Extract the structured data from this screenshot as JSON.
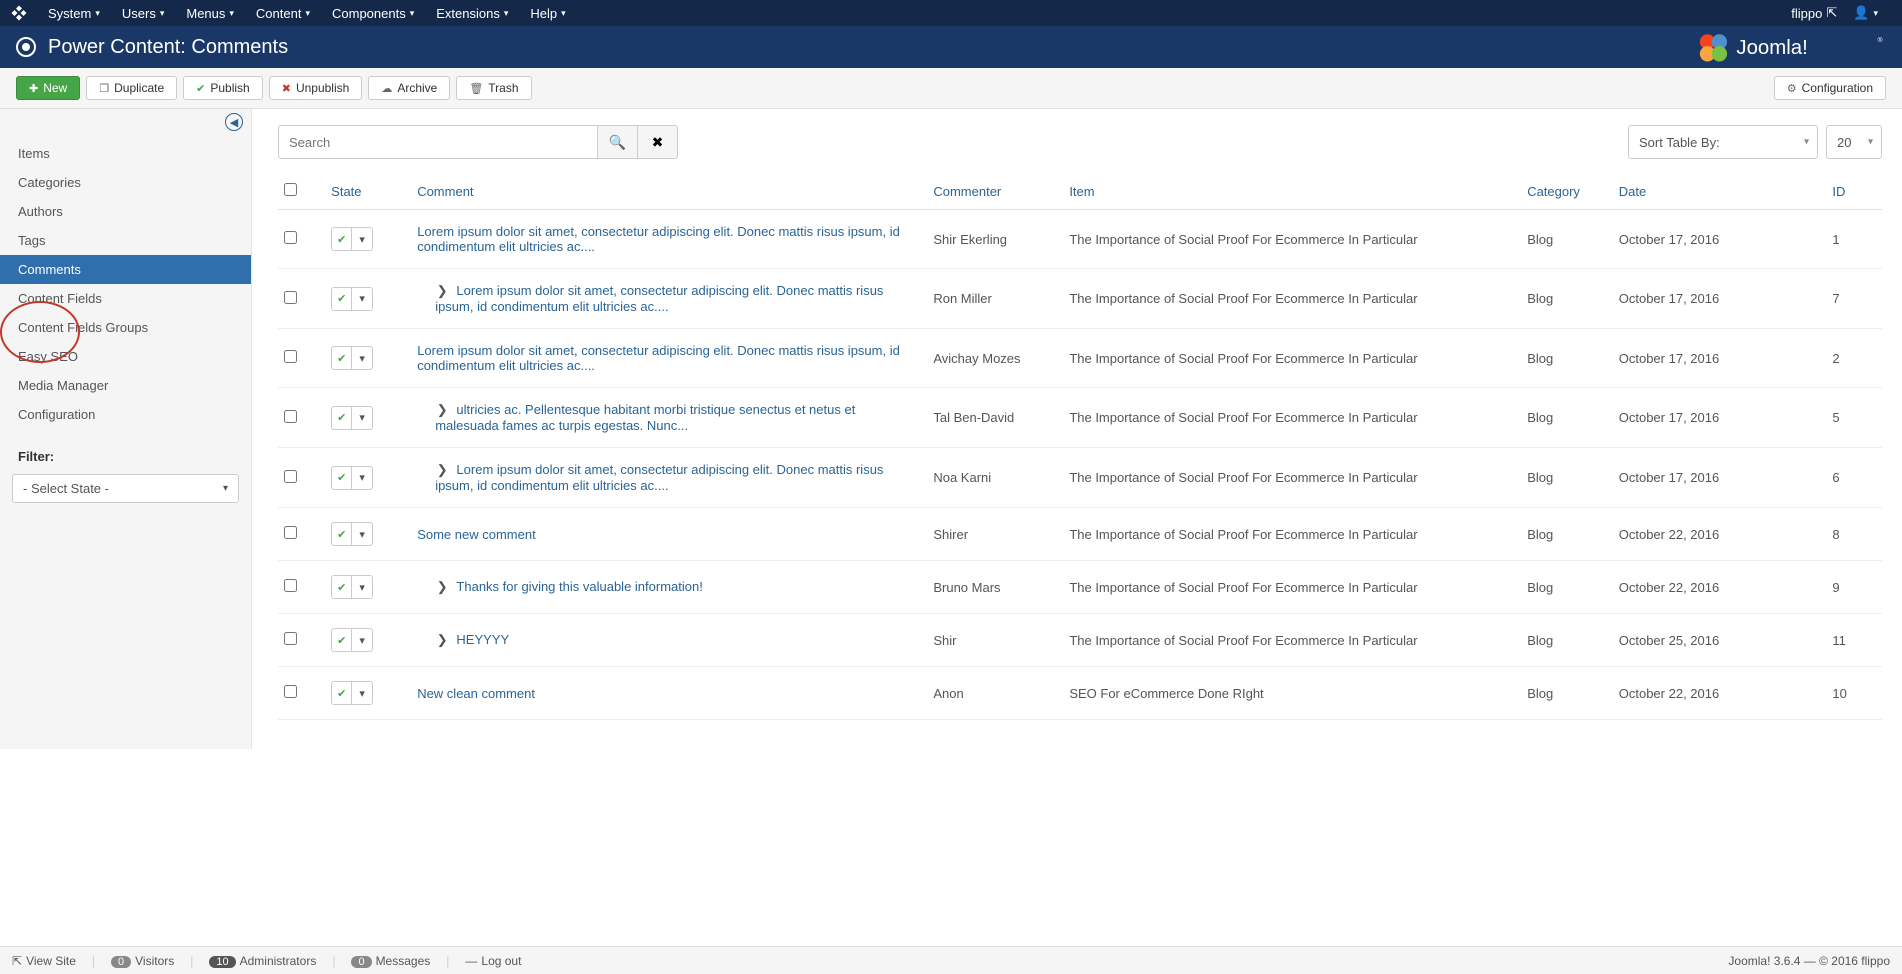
{
  "menubar": {
    "items": [
      "System",
      "Users",
      "Menus",
      "Content",
      "Components",
      "Extensions",
      "Help"
    ],
    "user": "flippo"
  },
  "header": {
    "title": "Power Content: Comments"
  },
  "toolbar": {
    "new": "New",
    "duplicate": "Duplicate",
    "publish": "Publish",
    "unpublish": "Unpublish",
    "archive": "Archive",
    "trash": "Trash",
    "configuration": "Configuration"
  },
  "sidebar": {
    "items": [
      "Items",
      "Categories",
      "Authors",
      "Tags",
      "Comments",
      "Content Fields",
      "Content Fields Groups",
      "Easy SEO",
      "Media Manager",
      "Configuration"
    ],
    "active_index": 4,
    "filter_label": "Filter:",
    "filter_value": "- Select State -"
  },
  "search": {
    "placeholder": "Search",
    "sort_label": "Sort Table By:",
    "limit": "20"
  },
  "table": {
    "headers": {
      "state": "State",
      "comment": "Comment",
      "commenter": "Commenter",
      "item": "Item",
      "category": "Category",
      "date": "Date",
      "id": "ID"
    },
    "rows": [
      {
        "indent": false,
        "comment": "Lorem ipsum dolor sit amet, consectetur adipiscing elit. Donec mattis risus ipsum, id condimentum elit ultricies ac....",
        "commenter": "Shir Ekerling",
        "item": "The Importance of Social Proof For Ecommerce In Particular",
        "category": "Blog",
        "date": "October 17, 2016",
        "id": "1"
      },
      {
        "indent": true,
        "comment": "Lorem ipsum dolor sit amet, consectetur adipiscing elit. Donec mattis risus ipsum, id condimentum elit ultricies ac....",
        "commenter": "Ron Miller",
        "item": "The Importance of Social Proof For Ecommerce In Particular",
        "category": "Blog",
        "date": "October 17, 2016",
        "id": "7"
      },
      {
        "indent": false,
        "comment": "Lorem ipsum dolor sit amet, consectetur adipiscing elit. Donec mattis risus ipsum, id condimentum elit ultricies ac....",
        "commenter": "Avichay Mozes",
        "item": "The Importance of Social Proof For Ecommerce In Particular",
        "category": "Blog",
        "date": "October 17, 2016",
        "id": "2"
      },
      {
        "indent": true,
        "comment": "ultricies ac. Pellentesque habitant morbi tristique senectus et netus et malesuada fames ac turpis egestas. Nunc...",
        "commenter": "Tal Ben-David",
        "item": "The Importance of Social Proof For Ecommerce In Particular",
        "category": "Blog",
        "date": "October 17, 2016",
        "id": "5"
      },
      {
        "indent": true,
        "comment": "Lorem ipsum dolor sit amet, consectetur adipiscing elit. Donec mattis risus ipsum, id condimentum elit ultricies ac....",
        "commenter": "Noa Karni",
        "item": "The Importance of Social Proof For Ecommerce In Particular",
        "category": "Blog",
        "date": "October 17, 2016",
        "id": "6"
      },
      {
        "indent": false,
        "comment": "Some new comment",
        "commenter": "Shirer",
        "item": "The Importance of Social Proof For Ecommerce In Particular",
        "category": "Blog",
        "date": "October 22, 2016",
        "id": "8"
      },
      {
        "indent": true,
        "comment": "Thanks for giving this valuable information!",
        "commenter": "Bruno Mars",
        "item": "The Importance of Social Proof For Ecommerce In Particular",
        "category": "Blog",
        "date": "October 22, 2016",
        "id": "9"
      },
      {
        "indent": true,
        "comment": "HEYYYY",
        "commenter": "Shir",
        "item": "The Importance of Social Proof For Ecommerce In Particular",
        "category": "Blog",
        "date": "October 25, 2016",
        "id": "11"
      },
      {
        "indent": false,
        "comment": "New clean comment",
        "commenter": "Anon",
        "item": "SEO For eCommerce Done RIght",
        "category": "Blog",
        "date": "October 22, 2016",
        "id": "10"
      }
    ]
  },
  "footer": {
    "view_site": "View Site",
    "visitors_count": "0",
    "visitors": "Visitors",
    "admins_count": "10",
    "admins": "Administrators",
    "messages_count": "0",
    "messages": "Messages",
    "logout": "Log out",
    "version": "Joomla! 3.6.4 — © 2016 flippo"
  }
}
